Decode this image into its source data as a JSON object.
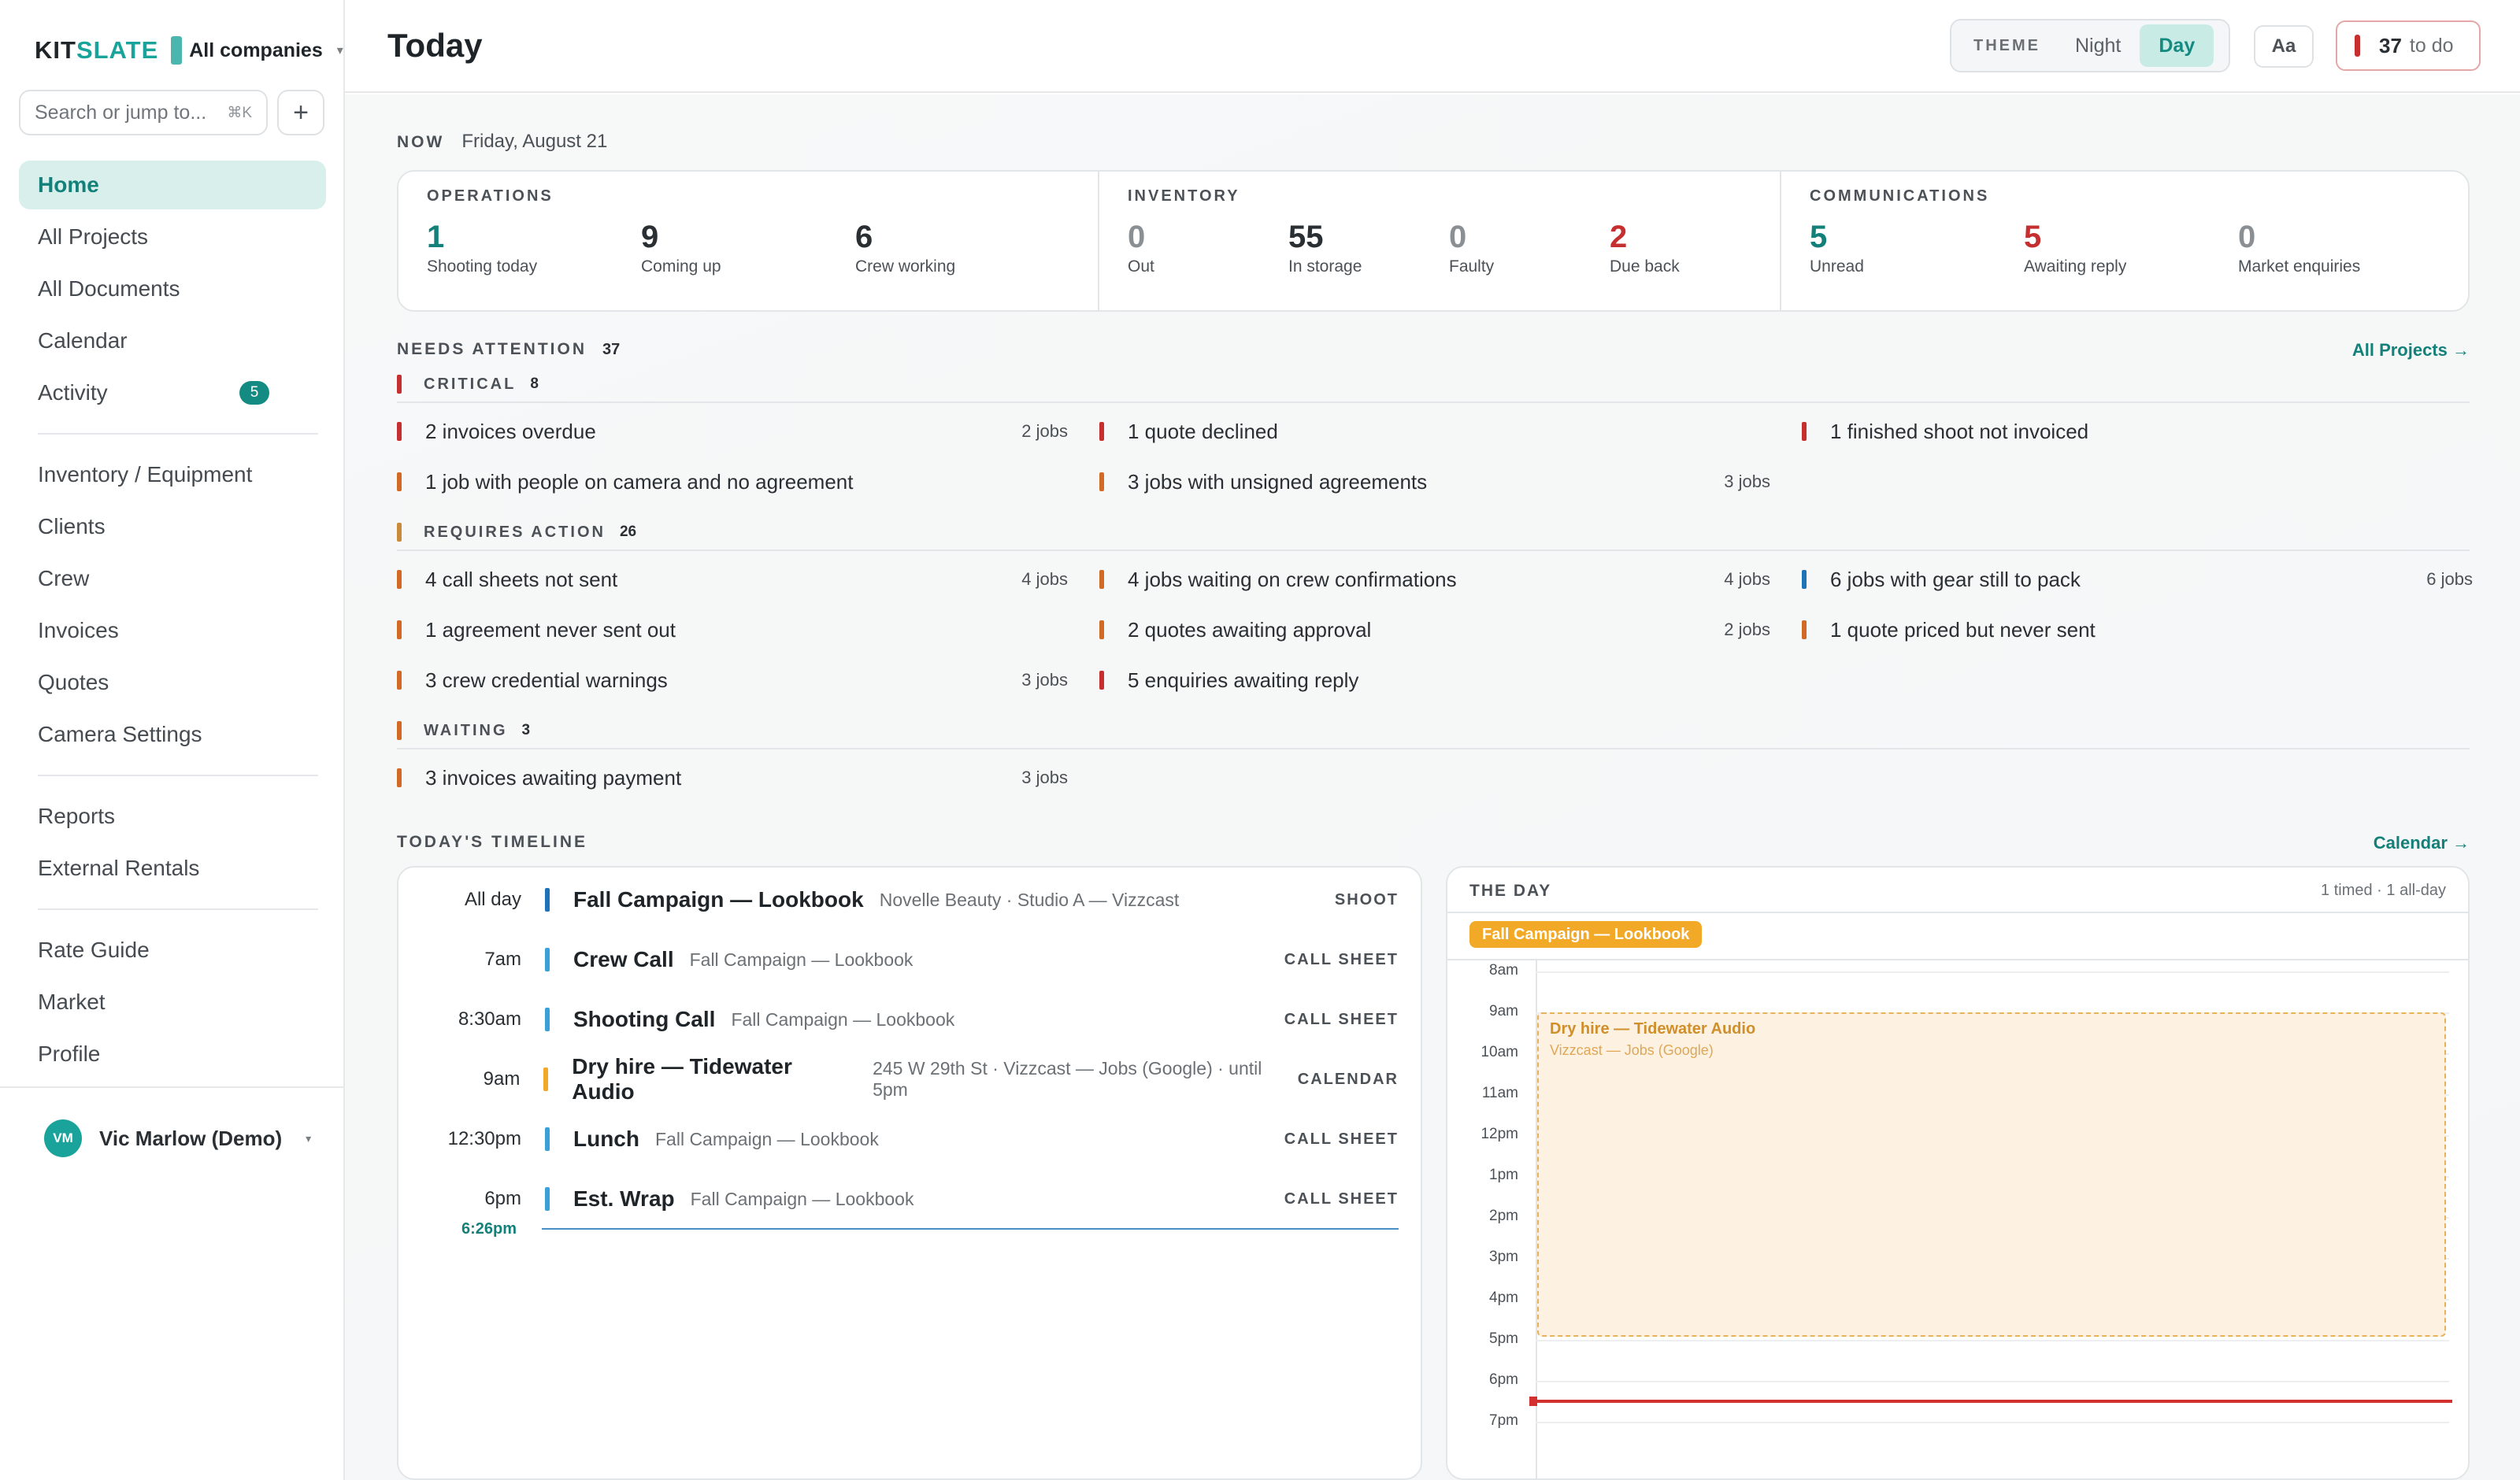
{
  "brand": {
    "logo_a": "KIT",
    "logo_b": "SLATE",
    "company": "All companies",
    "caret": "▾"
  },
  "search": {
    "placeholder": "Search or jump to...",
    "shortcut": "⌘K",
    "add": "+"
  },
  "nav": {
    "group1": [
      {
        "label": "Home",
        "active": true
      },
      {
        "label": "All Projects"
      },
      {
        "label": "All Documents"
      },
      {
        "label": "Calendar"
      },
      {
        "label": "Activity",
        "badge": "5"
      }
    ],
    "group2": [
      {
        "label": "Inventory / Equipment"
      },
      {
        "label": "Clients"
      },
      {
        "label": "Crew"
      },
      {
        "label": "Invoices"
      },
      {
        "label": "Quotes"
      },
      {
        "label": "Camera Settings"
      }
    ],
    "group3": [
      {
        "label": "Reports"
      },
      {
        "label": "External Rentals"
      }
    ],
    "group4": [
      {
        "label": "Rate Guide"
      },
      {
        "label": "Market"
      },
      {
        "label": "Profile"
      }
    ]
  },
  "user": {
    "initials": "VM",
    "name": "Vic Marlow (Demo)",
    "caret": "▾"
  },
  "header": {
    "title": "Today",
    "theme_label": "THEME",
    "theme_night": "Night",
    "theme_day": "Day",
    "font_button": "Aa",
    "todo_count": "37",
    "todo_label": "to do"
  },
  "now": {
    "label": "NOW",
    "date": "Friday, August 21"
  },
  "stats": {
    "operations": {
      "title": "OPERATIONS",
      "items": [
        {
          "value": "1",
          "label": "Shooting today"
        },
        {
          "value": "9",
          "label": "Coming up"
        },
        {
          "value": "6",
          "label": "Crew working"
        }
      ]
    },
    "inventory": {
      "title": "INVENTORY",
      "items": [
        {
          "value": "0",
          "label": "Out"
        },
        {
          "value": "55",
          "label": "In storage"
        },
        {
          "value": "0",
          "label": "Faulty"
        },
        {
          "value": "2",
          "label": "Due back"
        }
      ]
    },
    "communications": {
      "title": "COMMUNICATIONS",
      "items": [
        {
          "value": "5",
          "label": "Unread"
        },
        {
          "value": "5",
          "label": "Awaiting reply"
        },
        {
          "value": "0",
          "label": "Market enquiries"
        }
      ]
    }
  },
  "attention": {
    "title": "NEEDS ATTENTION",
    "count": "37",
    "link": "All Projects →",
    "critical": {
      "title": "CRITICAL",
      "count": "8"
    },
    "requires": {
      "title": "REQUIRES ACTION",
      "count": "26"
    },
    "waiting": {
      "title": "WAITING",
      "count": "3"
    },
    "tasks": {
      "c1": {
        "text": "2 invoices overdue",
        "jobs": "2 jobs"
      },
      "c2": {
        "text": "1 quote declined",
        "jobs": ""
      },
      "c3": {
        "text": "1 finished shoot not invoiced",
        "jobs": ""
      },
      "c4": {
        "text": "1 job with people on camera and no agreement",
        "jobs": ""
      },
      "c5": {
        "text": "3 jobs with unsigned agreements",
        "jobs": "3 jobs"
      },
      "r1": {
        "text": "4 call sheets not sent",
        "jobs": "4 jobs"
      },
      "r2": {
        "text": "4 jobs waiting on crew confirmations",
        "jobs": "4 jobs"
      },
      "r3": {
        "text": "6 jobs with gear still to pack",
        "jobs": "6 jobs"
      },
      "r4": {
        "text": "1 agreement never sent out",
        "jobs": ""
      },
      "r5": {
        "text": "2 quotes awaiting approval",
        "jobs": "2 jobs"
      },
      "r6": {
        "text": "1 quote priced but never sent",
        "jobs": ""
      },
      "r7": {
        "text": "3 crew credential warnings",
        "jobs": "3 jobs"
      },
      "r8": {
        "text": "5 enquiries awaiting reply",
        "jobs": ""
      },
      "w1": {
        "text": "3 invoices awaiting payment",
        "jobs": "3 jobs"
      }
    }
  },
  "timeline": {
    "title": "TODAY'S TIMELINE",
    "link": "Calendar →",
    "rows": [
      {
        "time": "All day",
        "name": "Fall Campaign — Lookbook",
        "sub": "Novelle Beauty · Studio A — Vizzcast",
        "type": "SHOOT"
      },
      {
        "time": "7am",
        "name": "Crew Call",
        "sub": "Fall Campaign — Lookbook",
        "type": "CALL SHEET"
      },
      {
        "time": "8:30am",
        "name": "Shooting Call",
        "sub": "Fall Campaign — Lookbook",
        "type": "CALL SHEET"
      },
      {
        "time": "9am",
        "name": "Dry hire — Tidewater Audio",
        "sub": "245 W 29th St · Vizzcast — Jobs (Google) · until 5pm",
        "type": "CALENDAR"
      },
      {
        "time": "12:30pm",
        "name": "Lunch",
        "sub": "Fall Campaign — Lookbook",
        "type": "CALL SHEET"
      },
      {
        "time": "6pm",
        "name": "Est. Wrap",
        "sub": "Fall Campaign — Lookbook",
        "type": "CALL SHEET"
      }
    ],
    "now_time": "6:26pm"
  },
  "day": {
    "title": "THE DAY",
    "meta": "1 timed · 1 all-day",
    "allday_event": "Fall Campaign — Lookbook",
    "hours": [
      "8am",
      "9am",
      "10am",
      "11am",
      "12pm",
      "1pm",
      "2pm",
      "3pm",
      "4pm",
      "5pm",
      "6pm",
      "7pm"
    ],
    "event": {
      "title": "Dry hire — Tidewater Audio",
      "sub": "Vizzcast — Jobs (Google)"
    }
  }
}
